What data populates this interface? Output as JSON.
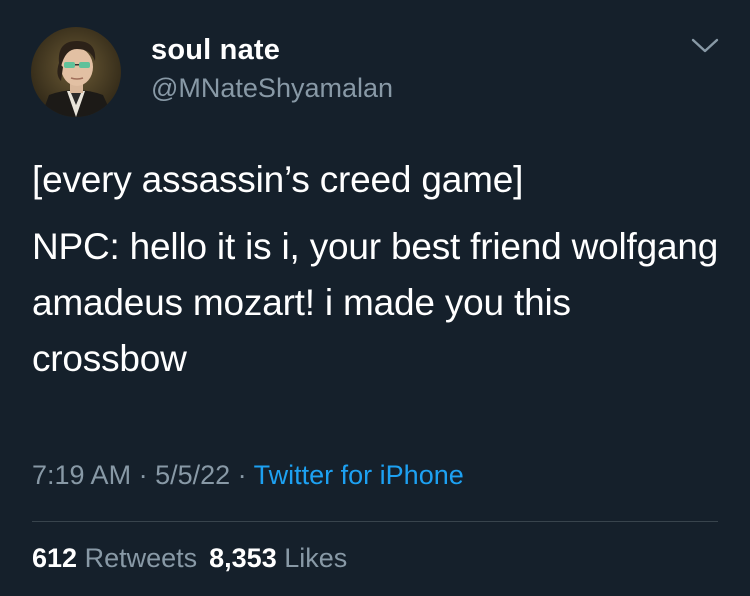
{
  "author": {
    "display_name": "soul nate",
    "handle": "@MNateShyamalan"
  },
  "tweet": {
    "paragraph_1": "[every assassin’s creed game]",
    "paragraph_2": "NPC: hello it is i, your best friend wolfgang amadeus mozart! i made you this crossbow"
  },
  "meta": {
    "time": "7:19 AM",
    "separator_1": " · ",
    "date": "5/5/22",
    "separator_2": " · ",
    "source": "Twitter for iPhone"
  },
  "stats": {
    "retweets_count": "612",
    "retweets_label": "Retweets",
    "likes_count": "8,353",
    "likes_label": "Likes"
  },
  "colors": {
    "background": "#15202b",
    "primary_text": "#ffffff",
    "secondary_text": "#8899a6",
    "link": "#1da1f2",
    "divider": "#38444d"
  },
  "icons": {
    "avatar": "avatar-portrait",
    "menu": "chevron-down-icon"
  }
}
